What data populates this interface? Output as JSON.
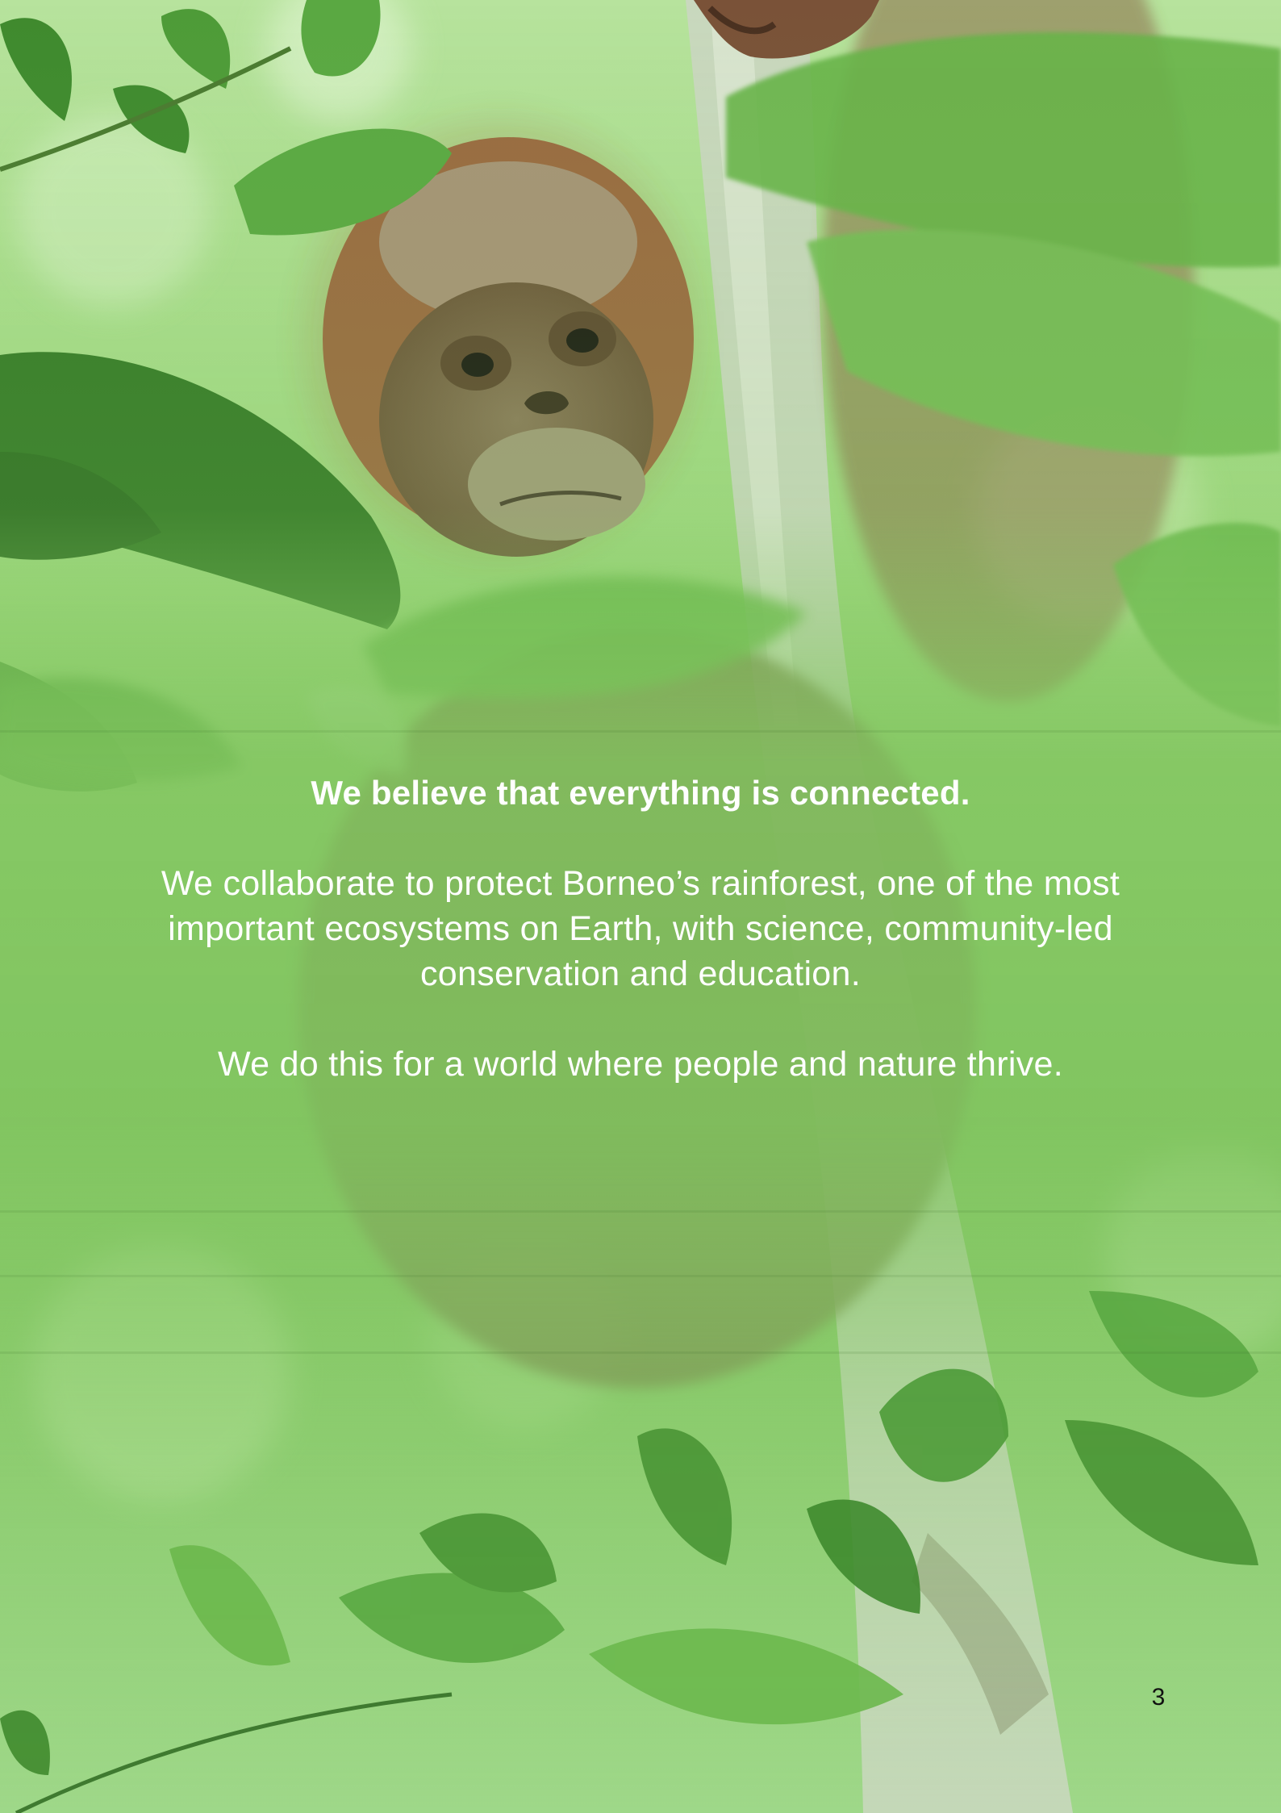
{
  "background_image": {
    "subject": "orangutan-photo"
  },
  "text": {
    "headline": "We believe that everything is connected.",
    "paragraph_1": "We collaborate to protect Borneo’s rainforest, one of the most important ecosystems on Earth, with science, community-led conservation and education.",
    "paragraph_2": "We do this for a world where people and nature thrive."
  },
  "footer": {
    "page_number": "3"
  },
  "colors": {
    "overlay_green": "#86c765",
    "leaf_dark": "#3f8a2e",
    "text": "#ffffff",
    "page_number": "#111111"
  }
}
